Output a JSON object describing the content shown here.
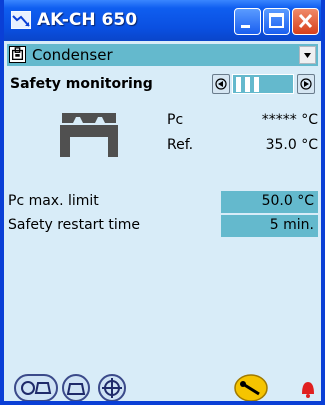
{
  "window": {
    "title": "AK-CH 650"
  },
  "combo": {
    "selected": "Condenser"
  },
  "section": {
    "title": "Safety monitoring",
    "page_position": "3 of 5"
  },
  "status": {
    "pc_label": "Pc",
    "pc_value": "***** °C",
    "ref_label": "Ref.",
    "ref_value": "35.0 °C"
  },
  "params": [
    {
      "label": "Pc max. limit",
      "value": "50.0 °C"
    },
    {
      "label": "Safety restart time",
      "value": "5 min."
    }
  ],
  "footer": {
    "buttons": [
      "controller-icon",
      "remote-icon",
      "navigation-icon",
      "wrench-icon",
      "alarm-bell-icon"
    ]
  },
  "colors": {
    "titlebar": "#0a4fe0",
    "highlight": "#64b9cd",
    "background": "#d8ecf8",
    "accent": "#f5c400",
    "alarm": "#e02020"
  }
}
